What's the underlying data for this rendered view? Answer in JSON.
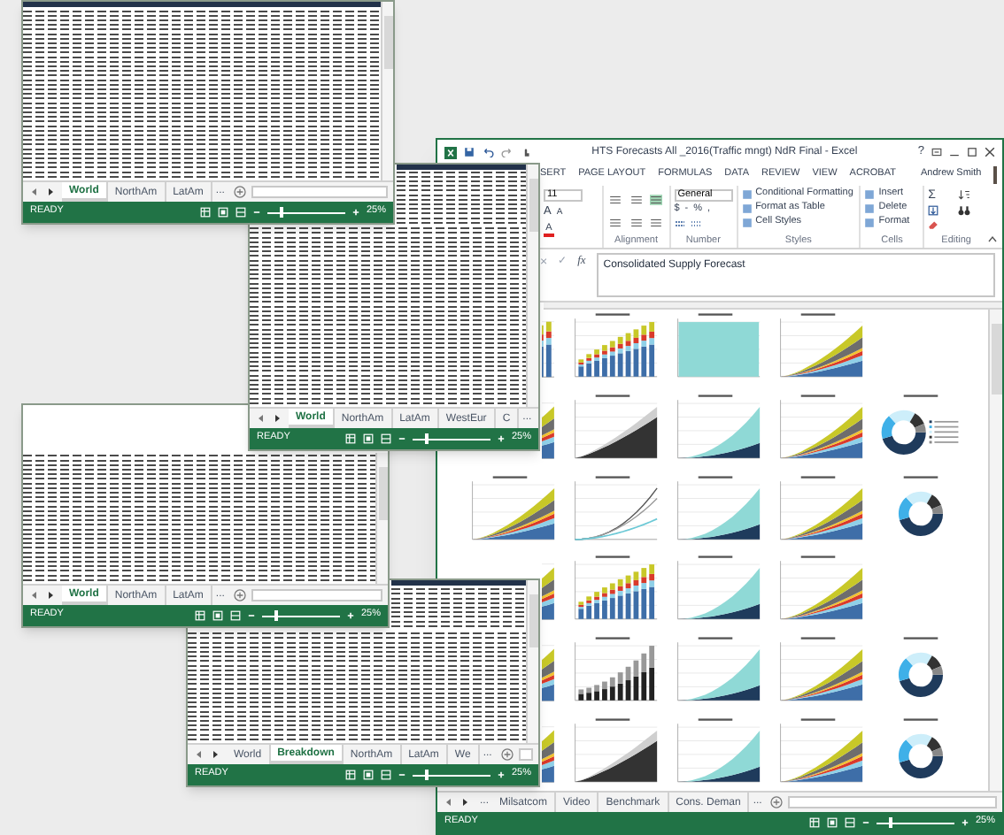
{
  "windows": [
    {
      "kind": "sheet",
      "tabs": [
        {
          "label": "World",
          "selected": true
        },
        {
          "label": "NorthAm",
          "selected": false
        },
        {
          "label": "LatAm",
          "selected": false
        }
      ],
      "overflow_right": "...",
      "status_bar": {
        "mode": "READY",
        "zoom": "25%",
        "zoom_slider": {
          "level": 0.15
        }
      }
    },
    {
      "kind": "sheet",
      "tabs": [
        {
          "label": "World",
          "selected": true
        },
        {
          "label": "NorthAm",
          "selected": false
        },
        {
          "label": "LatAm",
          "selected": false
        },
        {
          "label": "WestEur",
          "selected": false
        },
        {
          "label": "C",
          "selected": false
        }
      ],
      "overflow_right": "...",
      "status_bar": {
        "mode": "READY",
        "zoom": "25%",
        "zoom_slider": {
          "level": 0.15
        }
      }
    },
    {
      "kind": "workbook",
      "title": "HTS Forecasts All _2016(Traffic mngt) NdR Final - Excel",
      "help": "?",
      "ribbon_tabs": [
        "SERT",
        "PAGE LAYOUT",
        "FORMULAS",
        "DATA",
        "REVIEW",
        "VIEW",
        "ACROBAT"
      ],
      "user": "Andrew Smith",
      "font": {
        "size": "11",
        "grow": "A",
        "shrink": "A",
        "letter": "A"
      },
      "number": {
        "format": "General",
        "symbols": [
          "$",
          "-",
          "%",
          ","
        ]
      },
      "styles": [
        "Conditional Formatting",
        "Format as Table",
        "Cell Styles"
      ],
      "cells": [
        "Insert",
        "Delete",
        "Format"
      ],
      "editing": {
        "sum": "Σ"
      },
      "group_labels": [
        "Alignment",
        "Number",
        "Styles",
        "Cells",
        "Editing"
      ],
      "formula_bar": {
        "cancel": "×",
        "enter": "✓",
        "fx": "fx",
        "value": "Consolidated Supply Forecast"
      },
      "chart_rows": [
        {
          "charts": [
            {
              "kind": "stacked-bar"
            },
            {
              "kind": "stacked-bar"
            },
            {
              "kind": "full-area"
            },
            {
              "kind": "stacked-area"
            }
          ]
        },
        {
          "charts": [
            {
              "kind": "stacked-area"
            },
            {
              "kind": "dark-area"
            },
            {
              "kind": "two-area"
            },
            {
              "kind": "stacked-area"
            }
          ],
          "donut": {
            "legend": true
          }
        },
        {
          "charts": [
            {
              "kind": "stacked-area"
            },
            {
              "kind": "line"
            },
            {
              "kind": "two-area"
            },
            {
              "kind": "stacked-area"
            }
          ],
          "donut": {
            "legend": false
          }
        },
        {
          "charts": [
            {
              "kind": "stacked-area"
            },
            {
              "kind": "stacked-bar"
            },
            {
              "kind": "two-area"
            },
            {
              "kind": "stacked-area"
            }
          ]
        },
        {
          "charts": [
            {
              "kind": "stacked-area"
            },
            {
              "kind": "bar"
            },
            {
              "kind": "two-area"
            },
            {
              "kind": "stacked-area"
            }
          ],
          "donut": {
            "legend": false
          }
        },
        {
          "charts": [
            {
              "kind": "stacked-area"
            },
            {
              "kind": "dark-area"
            },
            {
              "kind": "two-area"
            },
            {
              "kind": "stacked-area"
            }
          ],
          "donut": {
            "legend": false
          }
        }
      ],
      "tabs": [
        {
          "label": "Milsatcom",
          "selected": false
        },
        {
          "label": "Video",
          "selected": false
        },
        {
          "label": "Benchmark",
          "selected": false
        },
        {
          "label": "Cons. Deman",
          "selected": false
        }
      ],
      "overflow_left": "...",
      "overflow_right": "...",
      "status_bar": {
        "mode": "READY",
        "zoom": "25%",
        "zoom_slider": {
          "level": 0.15
        }
      }
    },
    {
      "kind": "sheet",
      "tabs": [
        {
          "label": "World",
          "selected": true
        },
        {
          "label": "NorthAm",
          "selected": false
        },
        {
          "label": "LatAm",
          "selected": false
        }
      ],
      "overflow_right": "...",
      "status_bar": {
        "mode": "READY",
        "zoom": "25%",
        "zoom_slider": {
          "level": 0.15
        }
      }
    },
    {
      "kind": "sheet",
      "tabs": [
        {
          "label": "World",
          "selected": false
        },
        {
          "label": "Breakdown",
          "selected": true
        },
        {
          "label": "NorthAm",
          "selected": false
        },
        {
          "label": "LatAm",
          "selected": false
        },
        {
          "label": "We",
          "selected": false
        }
      ],
      "overflow_right": "...",
      "status_bar": {
        "mode": "READY",
        "zoom": "25%",
        "zoom_slider": {
          "level": 0.15
        }
      }
    }
  ]
}
